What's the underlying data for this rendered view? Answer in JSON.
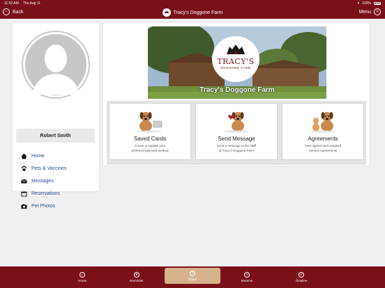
{
  "status": {
    "time": "11:02 AM",
    "date": "Thu Aug 11",
    "battery": "100%"
  },
  "header": {
    "back_label": "Back",
    "title": "Tracy's Doggone Farm",
    "menu_label": "Menu"
  },
  "profile": {
    "name": "Robert Smith"
  },
  "sidebar": {
    "items": [
      {
        "label": "Home",
        "icon": "home-icon"
      },
      {
        "label": "Pets & Vaccines",
        "icon": "paw-icon"
      },
      {
        "label": "Messages",
        "icon": "envelope-icon"
      },
      {
        "label": "Reservations",
        "icon": "calendar-icon"
      },
      {
        "label": "Pet Photos",
        "icon": "camera-icon"
      }
    ]
  },
  "hero": {
    "logo_main": "TRACY'S",
    "logo_sub": "DOGGONE FARM",
    "title": "Tracy's Doggone Farm"
  },
  "cards": [
    {
      "title": "Saved Cards",
      "desc_line1": "Create or Update your",
      "desc_line2": "preferred payment method"
    },
    {
      "title": "Send Message",
      "desc_line1": "Send a message to the staff",
      "desc_line2": "at Tracy's Doggone Farm"
    },
    {
      "title": "Agreements",
      "desc_line1": "View signed and unsigned",
      "desc_line2": "Service Agreements"
    }
  ],
  "tabs": [
    {
      "label": "Home",
      "icon": "home-icon"
    },
    {
      "label": "Reminder",
      "icon": "reminder-icon"
    },
    {
      "label": "Share",
      "icon": "share-icon"
    },
    {
      "label": "Reserve",
      "icon": "plus-icon"
    },
    {
      "label": "Timeline",
      "icon": "timeline-icon"
    }
  ],
  "colors": {
    "brand": "#7a1119",
    "accent_tab": "#d6b38c",
    "link": "#2a4a8f"
  }
}
